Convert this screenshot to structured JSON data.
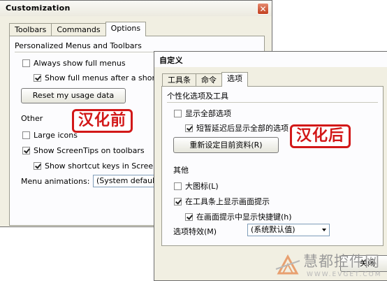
{
  "left_dialog": {
    "title": "Customization",
    "close_label": "✕",
    "tabs": [
      "Toolbars",
      "Commands",
      "Options"
    ],
    "group1": "Personalized Menus and Toolbars",
    "always_show": "Always show full menus",
    "show_after_delay": "Show full menus after a short delay",
    "reset_button": "Reset my usage data",
    "group2": "Other",
    "large_icons": "Large icons",
    "show_screentips": "Show ScreenTips on toolbars",
    "show_shortcuts": "Show shortcut keys in ScreenTips",
    "menu_animations_label": "Menu animations:",
    "menu_animations_value": "(System default)"
  },
  "right_dialog": {
    "title": "自定义",
    "tabs": [
      "工具条",
      "命令",
      "选项"
    ],
    "group1": "个性化选项及工具",
    "always_show": "显示全部选项",
    "show_after_delay": "短暂延迟后显示全部的选项",
    "reset_button": "重新设定目前资料(R)",
    "group2": "其他",
    "large_icons": "大图标(L)",
    "show_screentips": "在工具条上显示画面提示",
    "show_shortcuts": "在画面提示中显示快捷键(h)",
    "menu_animations_label": "选项特效(M)",
    "menu_animations_value": "(系统默认值)",
    "close_button": "关闭"
  },
  "stamps": {
    "before": "汉化前",
    "after": "汉化后"
  },
  "watermark": {
    "brand": "慧都控件网",
    "url": "WWW.EVGET.COM"
  },
  "colors": {
    "stamp_red": "#d21818",
    "dialog_bg": "#f1efe2",
    "panel_bg": "#fcfcfe",
    "watermark_grey": "#9a9a9a",
    "watermark_orange": "#e8a070"
  }
}
